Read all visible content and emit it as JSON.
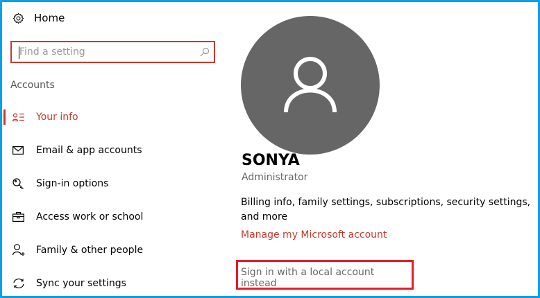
{
  "sidebar": {
    "home_label": "Home",
    "search_placeholder": "Find a setting",
    "section_title": "Accounts",
    "items": [
      {
        "label": "Your info",
        "icon": "person-list-icon",
        "active": true
      },
      {
        "label": "Email & app accounts",
        "icon": "mail-icon"
      },
      {
        "label": "Sign-in options",
        "icon": "key-icon"
      },
      {
        "label": "Access work or school",
        "icon": "briefcase-icon"
      },
      {
        "label": "Family & other people",
        "icon": "person-add-icon"
      },
      {
        "label": "Sync your settings",
        "icon": "sync-icon"
      }
    ]
  },
  "main": {
    "user_name": "SONYA",
    "user_role": "Administrator",
    "description": "Billing info, family settings, subscriptions, security settings, and more",
    "manage_link": "Manage my Microsoft account",
    "local_account_link": "Sign in with a local account instead"
  },
  "colors": {
    "accent": "#c8392b",
    "frame": "#0aa0e8",
    "highlight": "#e41d27",
    "avatar": "#666666"
  }
}
